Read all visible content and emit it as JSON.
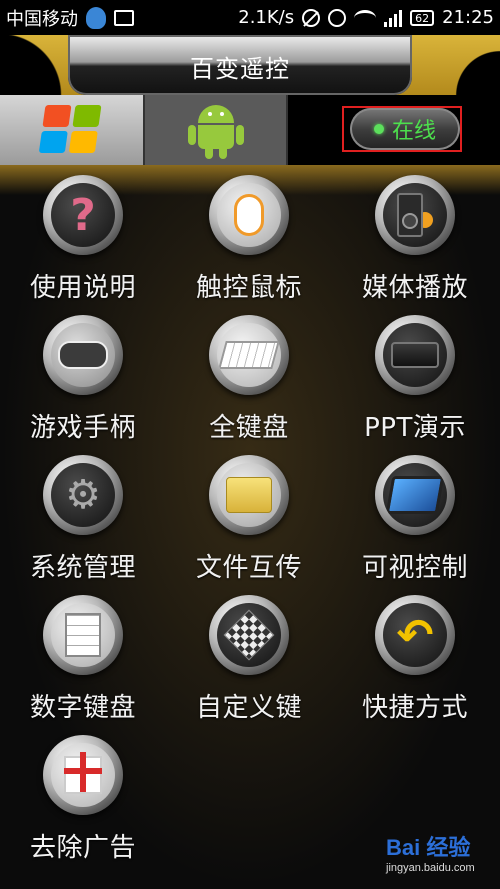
{
  "statusbar": {
    "carrier": "中国移动",
    "speed": "2.1K/s",
    "battery": "62",
    "time": "21:25"
  },
  "header": {
    "title": "百变遥控"
  },
  "tabs": {
    "windows": {
      "icon": "windows-logo-icon"
    },
    "android": {
      "icon": "android-icon"
    },
    "status": {
      "label": "在线",
      "color": "#4de04d"
    }
  },
  "grid": {
    "items": [
      {
        "label": "使用说明",
        "icon": "question-icon"
      },
      {
        "label": "触控鼠标",
        "icon": "mouse-icon"
      },
      {
        "label": "媒体播放",
        "icon": "media-icon"
      },
      {
        "label": "游戏手柄",
        "icon": "gamepad-icon"
      },
      {
        "label": "全键盘",
        "icon": "keyboard-icon"
      },
      {
        "label": "PPT演示",
        "icon": "projector-icon"
      },
      {
        "label": "系统管理",
        "icon": "gears-icon"
      },
      {
        "label": "文件互传",
        "icon": "folder-icon"
      },
      {
        "label": "可视控制",
        "icon": "tablet-icon"
      },
      {
        "label": "数字键盘",
        "icon": "numpad-icon"
      },
      {
        "label": "自定义键",
        "icon": "cube-icon"
      },
      {
        "label": "快捷方式",
        "icon": "shortcut-arrow-icon"
      },
      {
        "label": "去除广告",
        "icon": "gift-icon"
      }
    ]
  },
  "watermark": {
    "brand": "Bai 经验",
    "url": "jingyan.baidu.com"
  }
}
